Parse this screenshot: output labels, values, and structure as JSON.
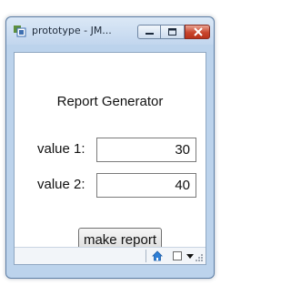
{
  "window": {
    "title": "prototype - JM...",
    "controls": [
      "minimize-icon",
      "maximize-icon",
      "close-icon"
    ]
  },
  "form": {
    "heading": "Report Generator",
    "fields": [
      {
        "label": "value 1:",
        "value": "30"
      },
      {
        "label": "value 2:",
        "value": "40"
      }
    ],
    "button_label": "make report"
  },
  "statusbar": {
    "icons": [
      "home-icon",
      "checkbox-icon",
      "dropdown-arrow-icon",
      "resize-grip-icon"
    ]
  },
  "colors": {
    "frame": "#bcd3ec",
    "close_button": "#c9452d",
    "home_icon": "#2f7fd6"
  }
}
